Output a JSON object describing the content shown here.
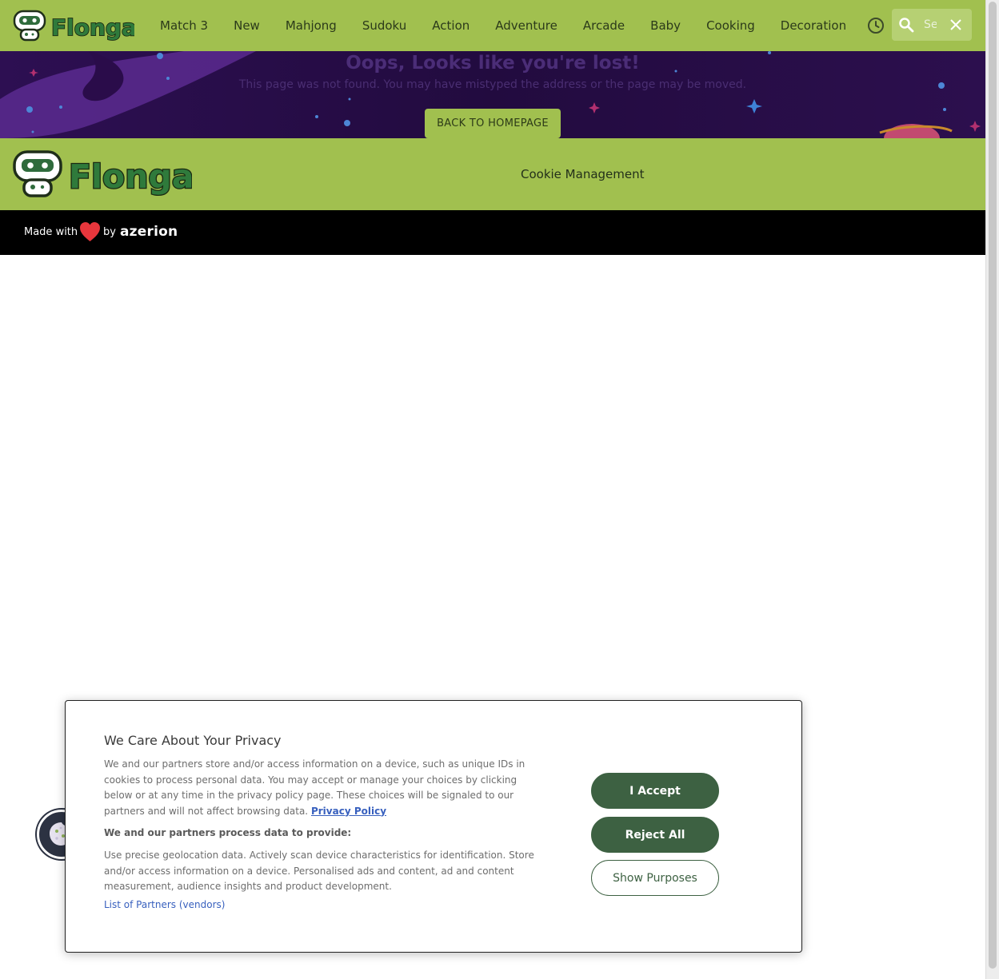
{
  "header": {
    "logo_text": "Flonga",
    "nav": [
      "Match 3",
      "New",
      "Mahjong",
      "Sudoku",
      "Action",
      "Adventure",
      "Arcade",
      "Baby",
      "Cooking",
      "Decoration"
    ],
    "search_placeholder": "Search"
  },
  "banner": {
    "title": "Oops, Looks like you're lost!",
    "message": "This page was not found. You may have mistyped the address or the page may be moved.",
    "back_button": "BACK TO HOMEPAGE"
  },
  "footer": {
    "logo_text": "Flonga",
    "cookie_management": "Cookie Management",
    "made_with": "Made with",
    "by": "by",
    "brand": "azerion"
  },
  "consent": {
    "title": "We Care About Your Privacy",
    "description": "We and our partners store and/or access information on a device, such as unique IDs in cookies to process personal data. You may accept or manage your choices by clicking below or at any time in the privacy policy page. These choices will be signaled to our partners and will not affect browsing data.",
    "privacy_link": "Privacy Policy",
    "subheading": "We and our partners process data to provide:",
    "purposes": "Use precise geolocation data. Actively scan device characteristics for identification. Store and/or access information on a device. Personalised ads and content, ad and content measurement, audience insights and product development.",
    "vendors_link": "List of Partners (vendors)",
    "accept": "I Accept",
    "reject": "Reject All",
    "show_purposes": "Show Purposes"
  },
  "colors": {
    "brand_green": "#a1c04f",
    "banner_purple": "#2a0f4a",
    "button_dark_green": "#3d6142",
    "link_blue": "#3860be"
  }
}
